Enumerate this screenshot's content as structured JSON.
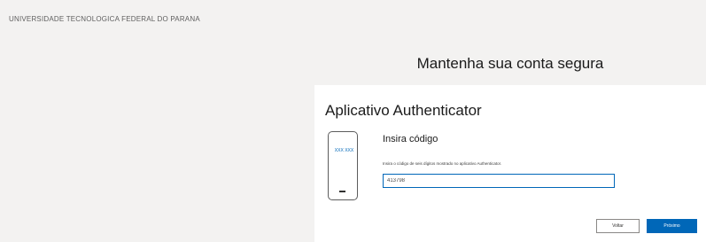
{
  "header": {
    "organization": "UNIVERSIDADE TECNOLOGICA FEDERAL DO PARANA"
  },
  "page": {
    "heading": "Mantenha sua conta segura"
  },
  "card": {
    "title": "Aplicativo Authenticator",
    "phone_screen_code": "XXX XXX",
    "step_title": "Insira código",
    "step_description": "Insira o código de seis dígitos mostrado no aplicativo Authenticator.",
    "code_input_value": "413798",
    "back_label": "Voltar",
    "next_label": "Próximo"
  },
  "colors": {
    "accent": "#0067b8",
    "background": "#f3f2f1",
    "card": "#ffffff"
  },
  "icons": {
    "phone": "mobile-phone-icon"
  }
}
